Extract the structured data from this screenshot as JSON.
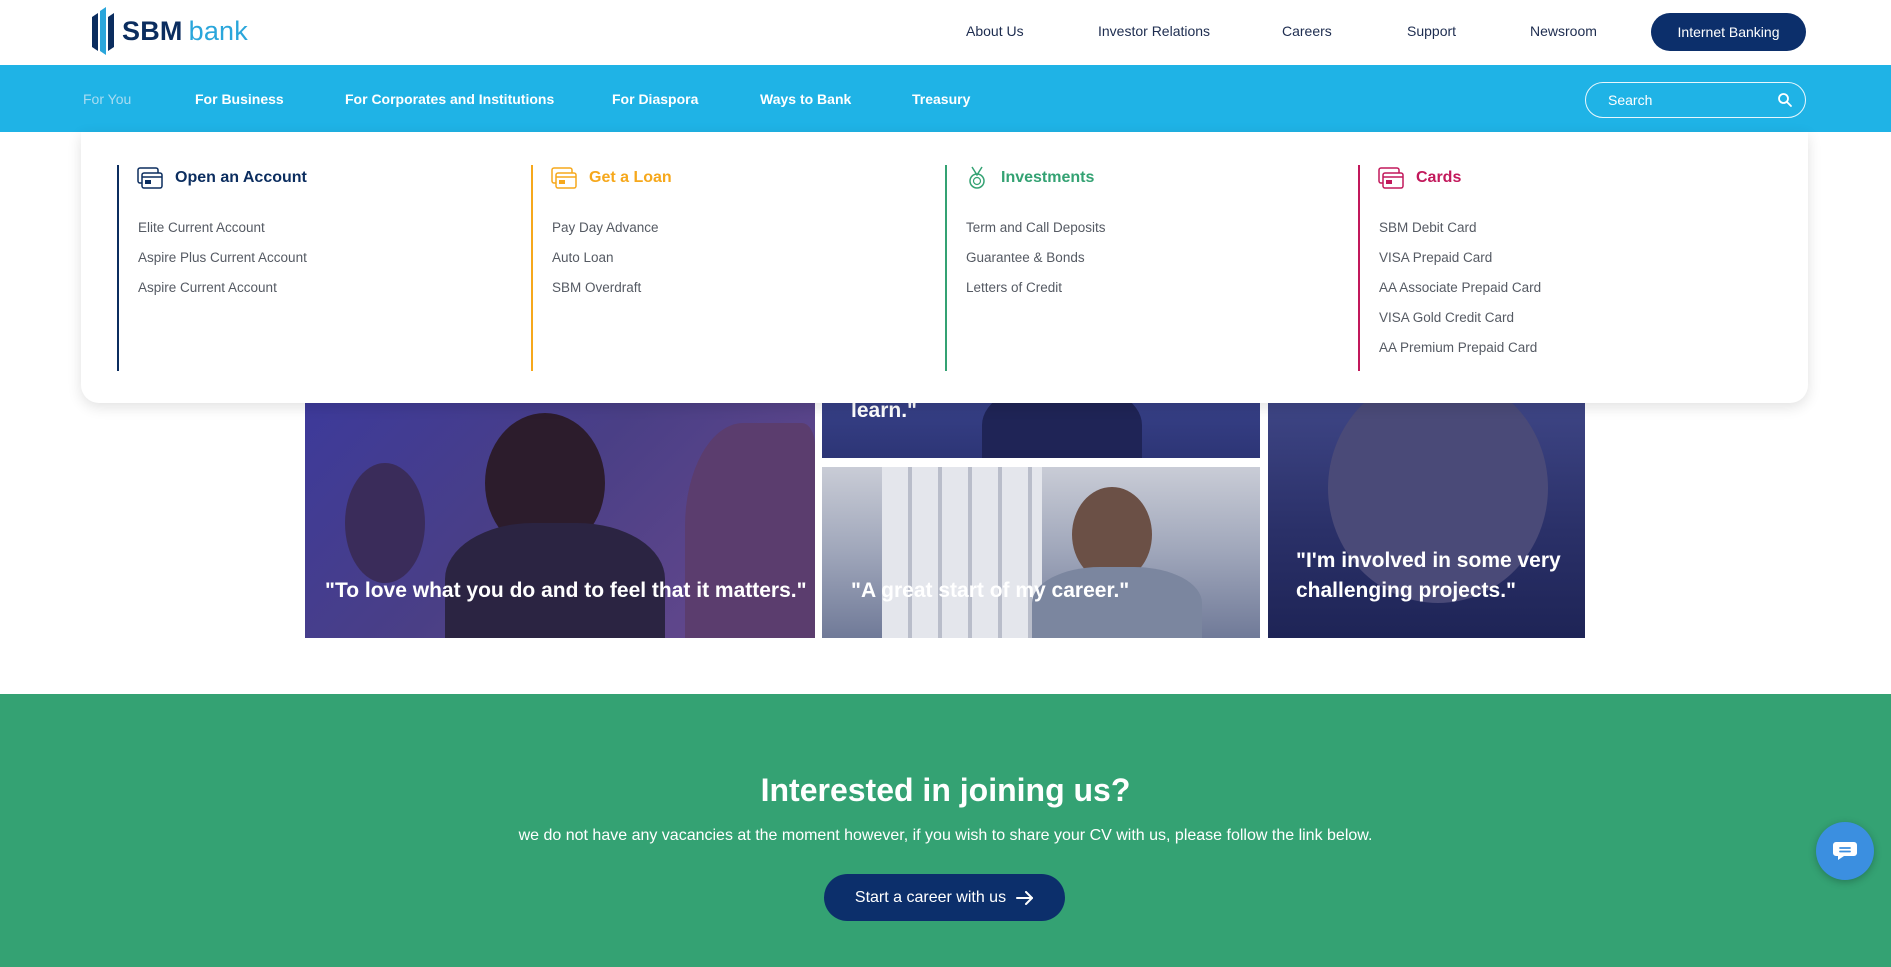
{
  "brand": {
    "name_bold": "SBM",
    "name_light": "bank",
    "color_primary": "#0c2f6b",
    "color_accent": "#1fb3e6"
  },
  "top_nav": {
    "links": [
      "About Us",
      "Investor Relations",
      "Careers",
      "Support",
      "Newsroom"
    ],
    "cta": "Internet Banking"
  },
  "main_nav": {
    "items": [
      "For You",
      "For Business",
      "For Corporates and Institutions",
      "For Diaspora",
      "Ways to Bank",
      "Treasury"
    ],
    "active": "For You",
    "search_placeholder": "Search"
  },
  "mega_menu": {
    "columns": [
      {
        "title": "Open an Account",
        "icon": "account-card-icon",
        "color": "#0b2d5f",
        "items": [
          "Elite Current Account",
          "Aspire Plus Current Account",
          "Aspire Current Account"
        ]
      },
      {
        "title": "Get a Loan",
        "icon": "loan-card-icon",
        "color": "#f6a81c",
        "items": [
          "Pay Day Advance",
          "Auto Loan",
          "SBM Overdraft"
        ]
      },
      {
        "title": "Investments",
        "icon": "medal-icon",
        "color": "#34a273",
        "items": [
          "Term and Call Deposits",
          "Guarantee & Bonds",
          "Letters of Credit"
        ]
      },
      {
        "title": "Cards",
        "icon": "credit-card-icon",
        "color": "#c2185b",
        "items": [
          "SBM Debit Card",
          "VISA Prepaid Card",
          "AA Associate Prepaid Card",
          "VISA Gold Credit Card",
          "AA Premium Prepaid Card"
        ]
      }
    ]
  },
  "testimonials": {
    "partial": "learn.\"",
    "quotes": [
      "\"To love what you do and to feel that it matters.\"",
      "\"A great start of my career.\"",
      "\"I'm involved in some very challenging projects.\""
    ]
  },
  "join": {
    "title": "Interested in joining us?",
    "text": "we do not have any vacancies at the moment however, if you wish to share your CV with us, please follow the link below.",
    "button": "Start a career with us"
  },
  "chat": {
    "icon": "chat-bubble-icon"
  }
}
